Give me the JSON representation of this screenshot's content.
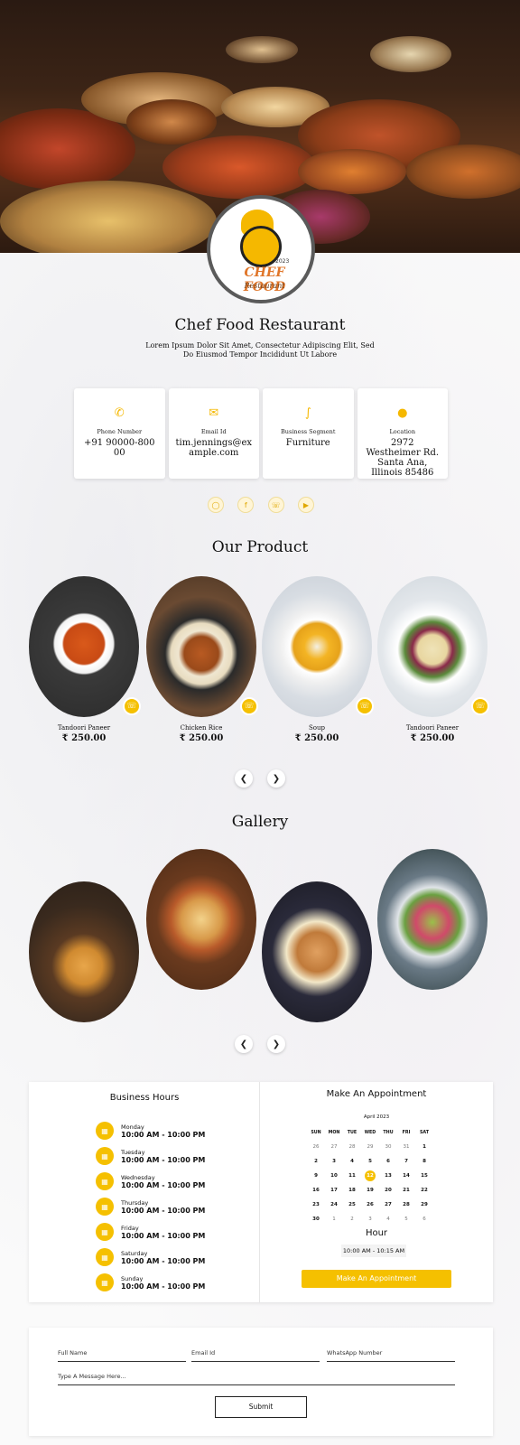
{
  "brand": {
    "logo_text": "CHEF FOOD",
    "logo_sub": "Restaurant",
    "logo_year": "2023"
  },
  "title": "Chef Food Restaurant",
  "subtitle": "Lorem Ipsum Dolor Sit Amet, Consectetur Adipiscing Elit, Sed Do Eiusmod Tempor Incididunt Ut Labore",
  "info": [
    {
      "icon": "phone-icon",
      "label": "Phone Number",
      "value": "+91 90000-80000"
    },
    {
      "icon": "email-icon",
      "label": "Email Id",
      "value": "tim.jennings@example.com"
    },
    {
      "icon": "segment-icon",
      "label": "Business Segment",
      "value": "Furniture"
    },
    {
      "icon": "location-icon",
      "label": "Location",
      "value": "2972 Westheimer Rd. Santa Ana, Illinois 85486"
    }
  ],
  "socials": [
    "instagram-icon",
    "facebook-icon",
    "whatsapp-icon",
    "youtube-icon"
  ],
  "products_title": "Our Product",
  "products": [
    {
      "name": "Tandoori Paneer",
      "price": "₹ 250.00"
    },
    {
      "name": "Chicken Rice",
      "price": "₹ 250.00"
    },
    {
      "name": "Soup",
      "price": "₹ 250.00"
    },
    {
      "name": "Tandoori Paneer",
      "price": "₹ 250.00"
    }
  ],
  "gallery_title": "Gallery",
  "hours": {
    "title": "Business Hours",
    "days": [
      {
        "day": "Monday",
        "time": "10:00 AM - 10:00 PM"
      },
      {
        "day": "Tuesday",
        "time": "10:00 AM - 10:00 PM"
      },
      {
        "day": "Wednesday",
        "time": "10:00 AM - 10:00 PM"
      },
      {
        "day": "Thursday",
        "time": "10:00 AM - 10:00 PM"
      },
      {
        "day": "Friday",
        "time": "10:00 AM - 10:00 PM"
      },
      {
        "day": "Saturday",
        "time": "10:00 AM - 10:00 PM"
      },
      {
        "day": "Sunday",
        "time": "10:00 AM - 10:00 PM"
      }
    ]
  },
  "appointment": {
    "title": "Make An Appointment",
    "month": "April 2023",
    "weekdays": [
      "SUN",
      "MON",
      "TUE",
      "WED",
      "THU",
      "FRI",
      "SAT"
    ],
    "weeks": [
      [
        "26",
        "27",
        "28",
        "29",
        "30",
        "31",
        "1"
      ],
      [
        "2",
        "3",
        "4",
        "5",
        "6",
        "7",
        "8"
      ],
      [
        "9",
        "10",
        "11",
        "12",
        "13",
        "14",
        "15"
      ],
      [
        "16",
        "17",
        "18",
        "19",
        "20",
        "21",
        "22"
      ],
      [
        "23",
        "24",
        "25",
        "26",
        "27",
        "28",
        "29"
      ],
      [
        "30",
        "1",
        "2",
        "3",
        "4",
        "5",
        "6"
      ]
    ],
    "selected": "12",
    "hour_label": "Hour",
    "hour_value": "10:00 AM - 10:15 AM",
    "button": "Make An Appointment"
  },
  "form": {
    "full_name": "Full Name",
    "email": "Email Id",
    "whatsapp": "WhatsApp Number",
    "message": "Type A Message Here...",
    "submit": "Submit"
  },
  "colors": {
    "accent": "#f5c000",
    "brand_orange": "#e0762a"
  }
}
